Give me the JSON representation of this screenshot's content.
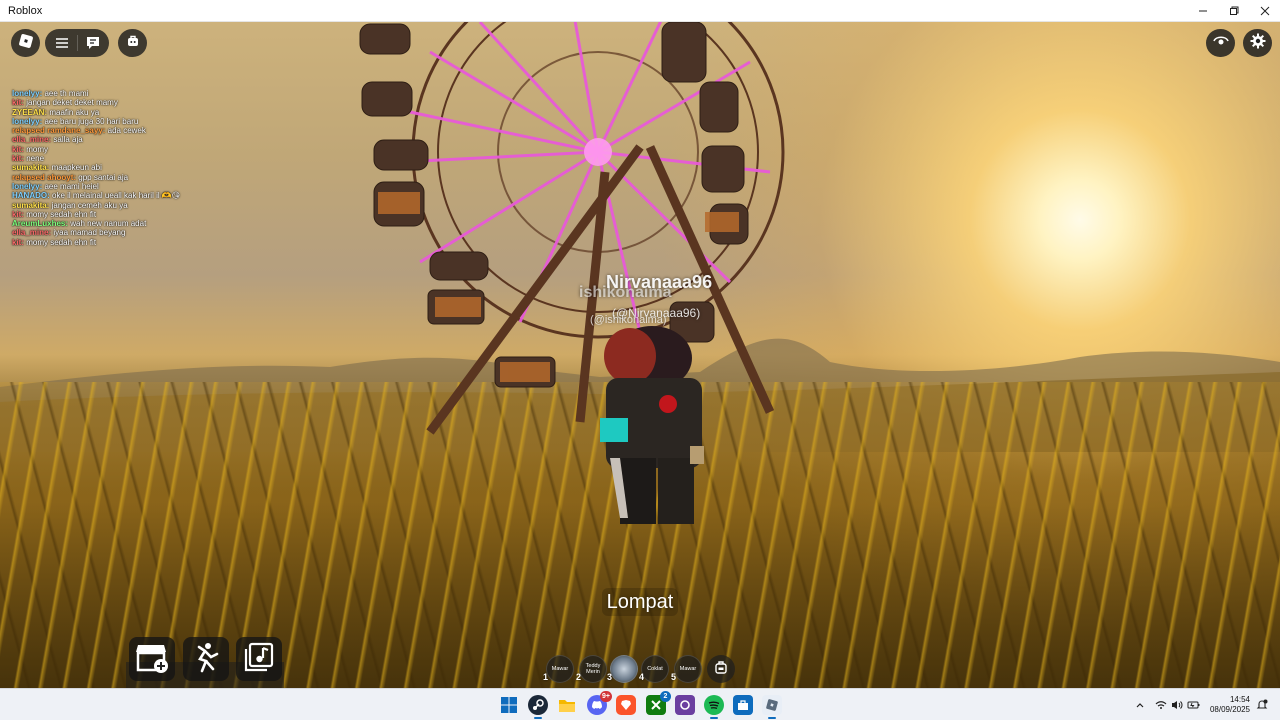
{
  "window": {
    "title": "Roblox",
    "controls": [
      "minimize",
      "restore",
      "close"
    ]
  },
  "chat": [
    {
      "name": "lonelyy:",
      "color": "#7fd1ff",
      "msg": "aee th mami"
    },
    {
      "name": "kit:",
      "color": "#ff6b6b",
      "msg": "jangan deket deket mamy"
    },
    {
      "name": "ZYEEAN:",
      "color": "#ffe04a",
      "msg": "maafin aku ya"
    },
    {
      "name": "lonelyy:",
      "color": "#7fd1ff",
      "msg": "aee baru juga 30 hari baru"
    },
    {
      "name": "relapsed ramdane_sayy:",
      "color": "#ff9a3c",
      "msg": "ada cewek"
    },
    {
      "name": "ella_mine:",
      "color": "#ff6b6b",
      "msg": "salla aja"
    },
    {
      "name": "kit:",
      "color": "#ff6b6b",
      "msg": "momy"
    },
    {
      "name": "kit:",
      "color": "#ff6b6b",
      "msg": "nene"
    },
    {
      "name": "sumakita:",
      "color": "#ffe04a",
      "msg": "maapkeun abi"
    },
    {
      "name": "relapsed ahooyt:",
      "color": "#ff9a3c",
      "msg": "gpp santai aja"
    },
    {
      "name": "lonelyy:",
      "color": "#7fd1ff",
      "msg": "aee mami heiel"
    },
    {
      "name": "HANADO:",
      "color": "#7fd1ff",
      "msg": "oke il melainal ueall kak haril il 🫶😘"
    },
    {
      "name": "sumakita:",
      "color": "#ffe04a",
      "msg": "jangan cemeh aku ya"
    },
    {
      "name": "kit:",
      "color": "#ff6b6b",
      "msg": "momy sedah ehn fit"
    },
    {
      "name": "AreumLuxhes:",
      "color": "#7dff7d",
      "msg": "wah new nanum adat"
    },
    {
      "name": "ella_mine:",
      "color": "#ff6b6b",
      "msg": "iyaa mamad beyang"
    },
    {
      "name": "kit:",
      "color": "#ff6b6b",
      "msg": "momy sedah ehn fit"
    }
  ],
  "nametags": {
    "player1_display": "Nirvanaaa96",
    "player1_user": "(@Nirvanaaa96)",
    "player2_display": "ishikonaima",
    "player2_user": "(@ishikonaima)"
  },
  "jump_label": "Lompat",
  "hotbar": [
    {
      "num": "1",
      "label": "Mawar"
    },
    {
      "num": "2",
      "label": "Teddy Merin"
    },
    {
      "num": "3",
      "label": ""
    },
    {
      "num": "4",
      "label": "Coklat"
    },
    {
      "num": "5",
      "label": "Mawar"
    }
  ],
  "taskbar": {
    "time": "14:54",
    "date": "08/09/2025",
    "discord_badge": "9+",
    "xbox_badge": "2",
    "accent": "#0f6cbd"
  },
  "icons": {
    "topleft": [
      "roblox-logo-icon",
      "hamburger-menu-icon",
      "chat-icon",
      "backpack-icon"
    ],
    "topright": [
      "eye-icon",
      "gear-icon"
    ],
    "bottomleft": [
      "shop-add-icon",
      "emote-dance-icon",
      "music-library-icon"
    ]
  }
}
